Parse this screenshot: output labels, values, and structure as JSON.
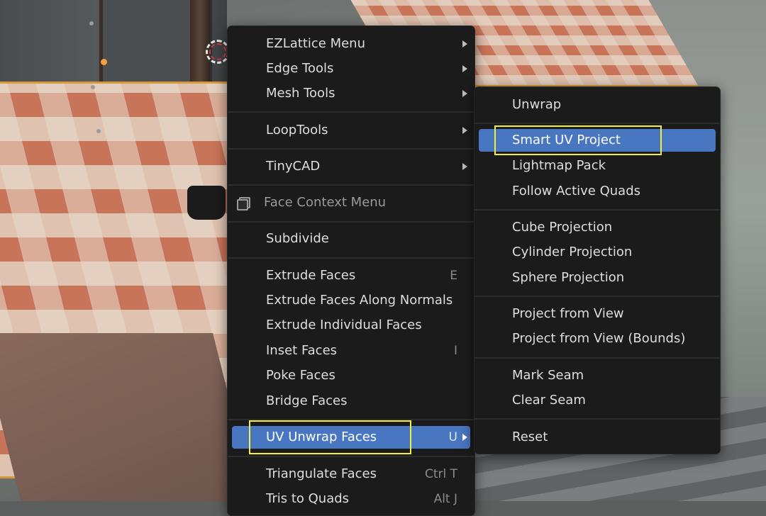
{
  "main_menu": {
    "items": [
      {
        "label": "EZLattice Menu",
        "submenu": true
      },
      {
        "label": "Edge Tools",
        "submenu": true
      },
      {
        "label": "Mesh Tools",
        "submenu": true
      },
      {
        "label": "LoopTools",
        "submenu": true
      },
      {
        "label": "TinyCAD",
        "submenu": true
      },
      {
        "label": "Face Context Menu",
        "header": true
      },
      {
        "label": "Subdivide"
      },
      {
        "label": "Extrude Faces",
        "shortcut": "E"
      },
      {
        "label": "Extrude Faces Along Normals"
      },
      {
        "label": "Extrude Individual Faces"
      },
      {
        "label": "Inset Faces",
        "shortcut": "I"
      },
      {
        "label": "Poke Faces"
      },
      {
        "label": "Bridge Faces"
      },
      {
        "label": "UV Unwrap Faces",
        "shortcut": "U",
        "submenu": true,
        "highlighted": true
      },
      {
        "label": "Triangulate Faces",
        "shortcut": "Ctrl T"
      },
      {
        "label": "Tris to Quads",
        "shortcut": "Alt J"
      }
    ]
  },
  "uv_submenu": {
    "items": [
      {
        "label": "Unwrap"
      },
      {
        "label": "Smart UV Project",
        "highlighted": true
      },
      {
        "label": "Lightmap Pack"
      },
      {
        "label": "Follow Active Quads"
      },
      {
        "label": "Cube Projection"
      },
      {
        "label": "Cylinder Projection"
      },
      {
        "label": "Sphere Projection"
      },
      {
        "label": "Project from View"
      },
      {
        "label": "Project from View (Bounds)"
      },
      {
        "label": "Mark Seam"
      },
      {
        "label": "Clear Seam"
      },
      {
        "label": "Reset"
      }
    ]
  },
  "colors": {
    "menu_bg": "#1b1b1b",
    "highlight": "#4876c0",
    "callout": "#f5ef3a",
    "text": "#dedede"
  },
  "icons": {
    "face_context_menu": "face-context-icon",
    "submenu_arrow": "submenu-arrow-icon"
  }
}
